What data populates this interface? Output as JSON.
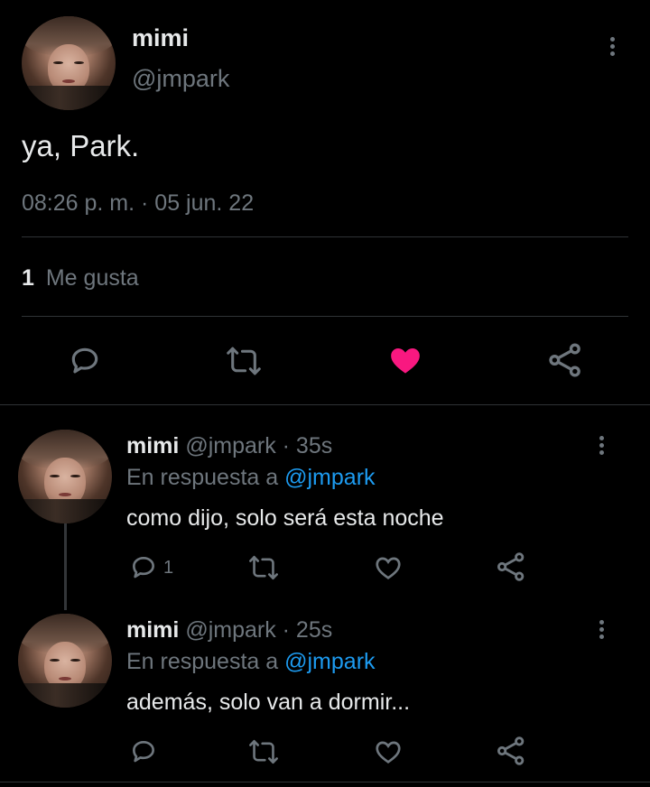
{
  "main_tweet": {
    "display_name": "mimi",
    "handle": "@jmpark",
    "text": "ya, Park.",
    "timestamp": "08:26 p. m. · 05 jun. 22",
    "likes_count": "1",
    "likes_label": "Me gusta",
    "liked": true
  },
  "replies": [
    {
      "display_name": "mimi",
      "handle": "@jmpark",
      "time": "· 35s",
      "reply_prefix": "En respuesta a",
      "reply_to": "@jmpark",
      "text": "como dijo, solo será esta noche",
      "reply_count": "1"
    },
    {
      "display_name": "mimi",
      "handle": "@jmpark",
      "time": "· 25s",
      "reply_prefix": "En respuesta a",
      "reply_to": "@jmpark",
      "text": "además, solo van a dormir...",
      "reply_count": ""
    }
  ],
  "colors": {
    "background": "#000000",
    "text": "#e7e9ea",
    "muted": "#6e767d",
    "link": "#1d9bf0",
    "like": "#f91880"
  },
  "icons": [
    "reply-icon",
    "retweet-icon",
    "like-icon",
    "share-icon",
    "more-options-icon"
  ]
}
